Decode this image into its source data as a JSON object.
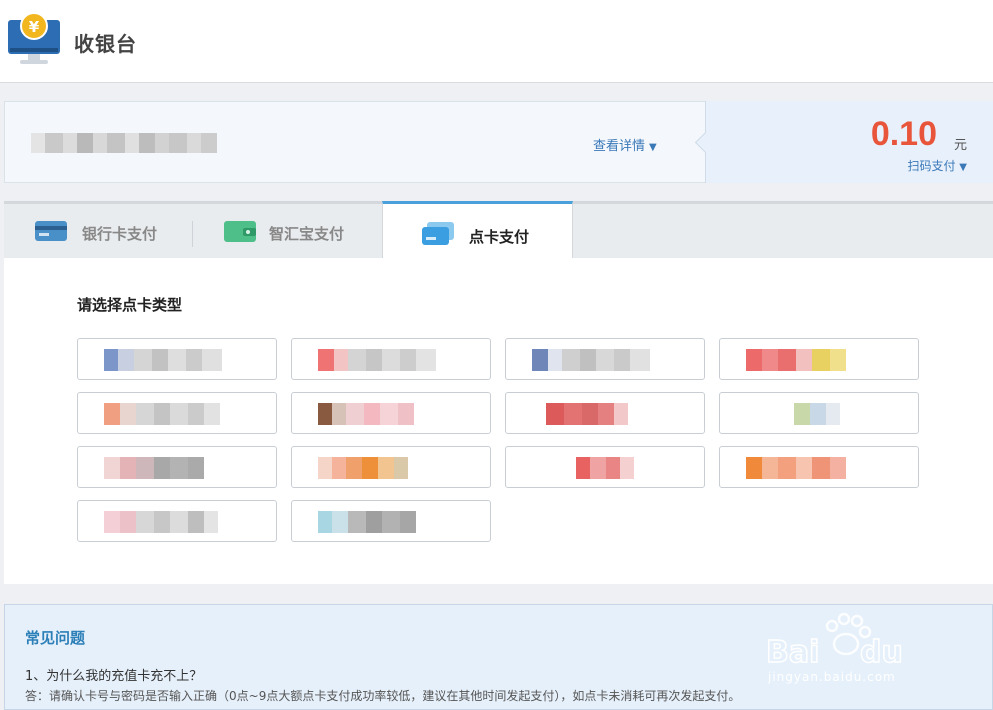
{
  "header": {
    "title": "收银台",
    "logo_icon": "monitor-yuan-icon"
  },
  "order": {
    "detail_label": "查看详情",
    "amount": "0.10",
    "currency": "元",
    "scan_pay_label": "扫码支付"
  },
  "tabs": [
    {
      "label": "银行卡支付",
      "icon": "bank-card-icon",
      "active": false
    },
    {
      "label": "智汇宝支付",
      "icon": "wallet-icon",
      "active": false
    },
    {
      "label": "点卡支付",
      "icon": "point-card-icon",
      "active": true
    }
  ],
  "card_section": {
    "title": "请选择点卡类型",
    "card_count": 14
  },
  "faq": {
    "title": "常见问题",
    "question": "1、为什么我的充值卡充不上？",
    "answer": "答：请确认卡号与密码是否输入正确（0点~9点大额点卡支付成功率较低，建议在其他时间发起支付），如点卡未消耗可再次发起支付。"
  },
  "watermark": {
    "text": "jingyan.baidu.com"
  },
  "colors": {
    "accent": "#4aa0da",
    "amount": "#e8553b",
    "link": "#3a78b8"
  }
}
